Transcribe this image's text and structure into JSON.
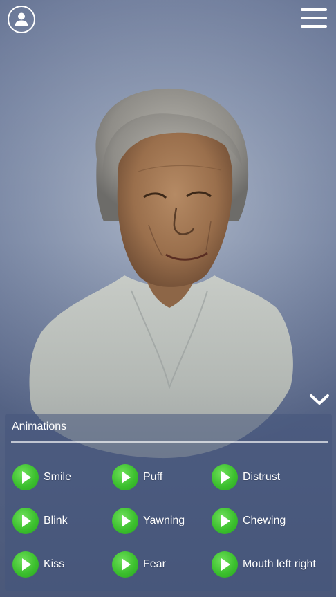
{
  "header": {
    "profile_icon": "user-circle-icon",
    "menu_icon": "hamburger-menu-icon"
  },
  "viewer": {
    "collapse_icon": "chevron-down-icon"
  },
  "animations": {
    "title": "Animations",
    "play_icon": "play-icon",
    "accent_color": "#3cc02e",
    "items": [
      {
        "label": "Smile"
      },
      {
        "label": "Puff"
      },
      {
        "label": "Distrust"
      },
      {
        "label": "Blink"
      },
      {
        "label": "Yawning"
      },
      {
        "label": "Chewing"
      },
      {
        "label": "Kiss"
      },
      {
        "label": "Fear"
      },
      {
        "label": "Mouth left right"
      }
    ]
  }
}
